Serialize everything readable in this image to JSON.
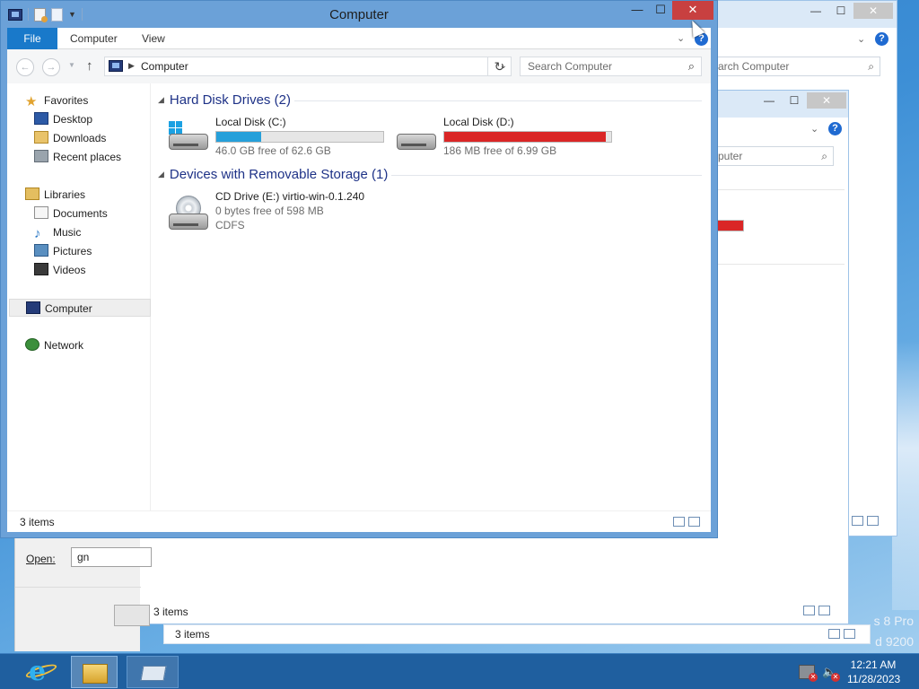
{
  "desktop": {
    "watermark_line1": "s 8 Pro",
    "watermark_line2": "d 9200"
  },
  "background_windows": {
    "win1": {
      "search_placeholder": "arch Computer",
      "status": "3 items"
    },
    "win2": {
      "search_placeholder": "puter",
      "status": "3 items"
    }
  },
  "run_dialog": {
    "open_label": "Open:",
    "open_value": "gn"
  },
  "window": {
    "title": "Computer",
    "controls": {
      "minimize": "—",
      "maximize": "☐",
      "close": "✕"
    },
    "ribbon_tabs": [
      "File",
      "Computer",
      "View"
    ],
    "address": {
      "path": "Computer",
      "search_placeholder": "Search Computer"
    },
    "nav": {
      "favorites": "Favorites",
      "desktop": "Desktop",
      "downloads": "Downloads",
      "recent_places": "Recent places",
      "libraries": "Libraries",
      "documents": "Documents",
      "music": "Music",
      "pictures": "Pictures",
      "videos": "Videos",
      "computer": "Computer",
      "network": "Network"
    },
    "groups": [
      {
        "header": "Hard Disk Drives (2)",
        "drives": [
          {
            "name": "Local Disk (C:)",
            "info": "46.0 GB free of 62.6 GB",
            "used_fraction": 0.27,
            "bar_color": "#26a0da",
            "icon": "windows-drive-icon"
          },
          {
            "name": "Local Disk (D:)",
            "info": "186 MB free of 6.99 GB",
            "used_fraction": 0.97,
            "bar_color": "#da2626",
            "icon": "hard-drive-icon"
          }
        ]
      },
      {
        "header": "Devices with Removable Storage (1)",
        "drives": [
          {
            "name": "CD Drive (E:) virtio-win-0.1.240",
            "info": "0 bytes free of 598 MB",
            "fs": "CDFS",
            "icon": "cd-drive-icon"
          }
        ]
      }
    ],
    "status": "3 items"
  },
  "taskbar": {
    "apps": [
      "internet-explorer-icon",
      "file-explorer-icon",
      "run-icon"
    ],
    "time": "12:21 AM",
    "date": "11/28/2023"
  },
  "colors": {
    "accent": "#1979ca",
    "titlebar": "#6ba1d8",
    "close": "#c84040",
    "group_header": "#1e3287",
    "bar_blue": "#26a0da",
    "bar_red": "#da2626"
  }
}
